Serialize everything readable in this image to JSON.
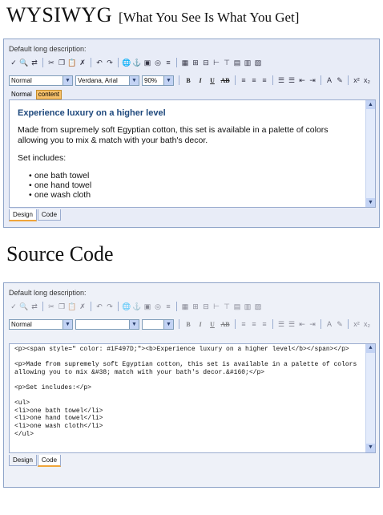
{
  "heading_top": {
    "big": "WYSIWYG",
    "small": "[What You See Is What You Get]"
  },
  "heading_bottom": "Source Code",
  "panel_label": "Default long description:",
  "format_select": {
    "block": "Normal",
    "font": "Verdana, Arial",
    "zoom": "90%"
  },
  "tag_path": [
    "Normal",
    "content"
  ],
  "format_buttons": [
    "B",
    "I",
    "U",
    "AB"
  ],
  "rendered": {
    "heading": "Experience luxury on a higher level",
    "heading_color": "#1F497D",
    "paragraph": "Made from supremely soft Egyptian cotton, this set is available in a palette of colors allowing you to mix & match with your bath's decor.",
    "set_includes": "Set includes:",
    "items": [
      "one bath towel",
      "one hand towel",
      "one wash cloth"
    ]
  },
  "source_lines": [
    "<p><span style=\" color: #1F497D;\"><b>Experience luxury on a higher level</b></span></p>",
    "",
    "<p>Made from supremely soft Egyptian cotton, this set is available in a palette of colors",
    "allowing you to mix &#38; match with your bath's decor.&#160;</p>",
    "",
    "<p>Set includes:</p>",
    "",
    "<ul>",
    "<li>one bath towel</li>",
    "<li>one hand towel</li>",
    "<li>one wash cloth</li>",
    "</ul>"
  ],
  "tabs": [
    "Design",
    "Code"
  ]
}
